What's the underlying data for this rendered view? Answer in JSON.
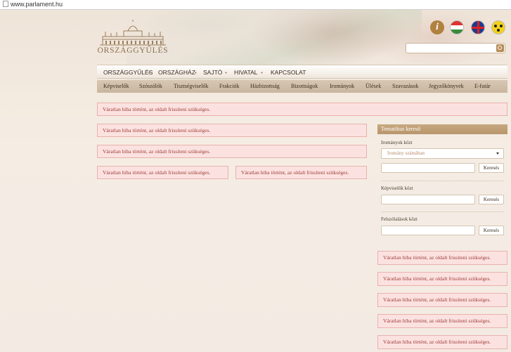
{
  "browser": {
    "url": "www.parlament.hu"
  },
  "header": {
    "logo_text": "ORSZÁGGYŰLÉS",
    "search_placeholder": ""
  },
  "icons": {
    "info": "info-icon",
    "hungarian": "hungarian-flag-icon",
    "english": "uk-flag-icon",
    "accessibility": "accessibility-icon",
    "search": "search-icon"
  },
  "nav_main": [
    "ORSZÁGGYŰLÉS",
    "ORSZÁGHÁZ",
    "SAJTÓ",
    "HIVATAL",
    "KAPCSOLAT"
  ],
  "nav_sub": [
    "Képviselők",
    "Szószólók",
    "Tisztségviselők",
    "Frakciók",
    "Házbizottság",
    "Bizottságok",
    "Irományok",
    "Ülések",
    "Szavazások",
    "Jegyzőkönyvek",
    "E-futár"
  ],
  "error_message": "Váratlan hiba történt, az oldalt frissíteni szükséges.",
  "panel": {
    "title": "Tematikus kereső",
    "sections": [
      {
        "label": "Irományok közt",
        "select_value": "Iromány számában",
        "button": "Keresés"
      },
      {
        "label": "Képviselők közt",
        "button": "Keresés"
      },
      {
        "label": "Felszólalások közt",
        "button": "Keresés"
      }
    ]
  },
  "colors": {
    "error_bg": "#fbe2e0",
    "error_text": "#9e3a36",
    "panel_header": "#b8966c",
    "nav_sub_bg": "#c9b69f"
  }
}
